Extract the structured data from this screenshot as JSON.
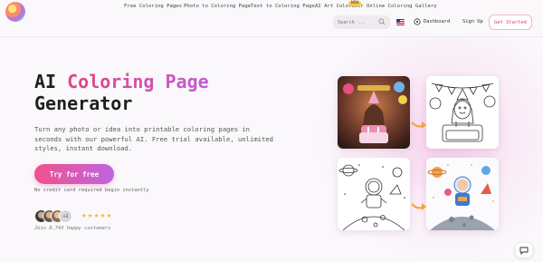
{
  "nav": {
    "links": [
      "Free Coloring Pages",
      "Photo to Coloring Page",
      "Text to Coloring Page",
      "AI Art Colorizer",
      "Online Coloring",
      "Gallery"
    ],
    "new_badge": "NEW"
  },
  "search": {
    "placeholder": "Search ..."
  },
  "header": {
    "dashboard_label": "Dashboard",
    "signup_label": "Sign Up",
    "get_started_label": "Get Started"
  },
  "hero": {
    "title_line1_prefix": "AI ",
    "title_line1_highlight": "Coloring Page",
    "title_line2": "Generator",
    "description": "Turn any photo or idea into printable coloring pages in seconds with our powerful AI. Free trial available, unlimited styles, instant download.",
    "cta_label": "Try for free",
    "no_card_text": "No credit card required begin instantly",
    "avatar_more": "+2",
    "stars": [
      "★",
      "★",
      "★",
      "★",
      "★"
    ],
    "rating_value": 5,
    "join_text": "Join 8,743 happy customers"
  },
  "colors": {
    "accent_pink": "#e0457b",
    "accent_purple": "#c25cd6",
    "arrow_orange": "#f5a13a",
    "star_gold": "#f4b731"
  },
  "icons": {
    "search": "search-icon",
    "flag": "us-flag-icon",
    "dashboard": "dashboard-icon",
    "arrow": "arrow-right-icon",
    "chat": "chat-icon"
  }
}
